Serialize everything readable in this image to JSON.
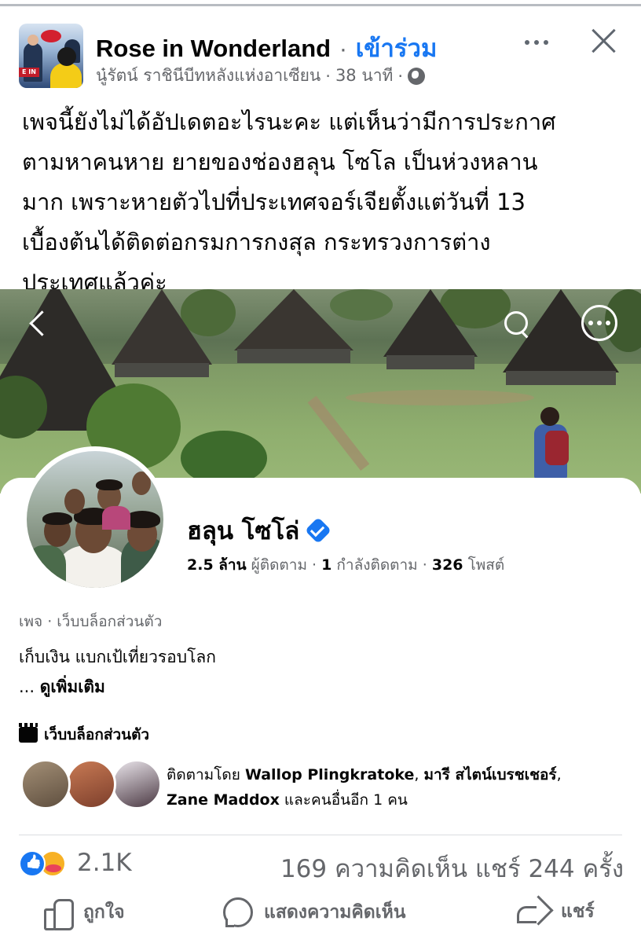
{
  "post": {
    "page_name": "Rose in Wonderland",
    "separator": "·",
    "join_label": "เข้าร่วม",
    "author": "นู๋รัตน์ ราชินีบีทหลังแห่งอาเซียน",
    "time": "38 นาที",
    "text_lines": [
      "เพจนี้ยังไม่ได้อัปเดตอะไรนะคะ แต่เห็นว่ามีการประกาศ",
      "ตามหาคนหาย ยายของช่องฮลุน โซโล เป็นห่วงหลาน",
      "มาก เพราะหายตัวไปที่ประเทศจอร์เจียตั้งแต่วันที่ 13",
      "เบื้องต้นได้ติดต่อกรมการกงสุล กระทรวงการต่าง",
      "ประเทศแล้วค่ะ"
    ]
  },
  "profile": {
    "name": "ฮลุน โซโล่",
    "followers_value": "2.5 ล้าน",
    "followers_label": "ผู้ติดตาม",
    "following_value": "1",
    "following_label": "กำลังติดตาม",
    "posts_value": "326",
    "posts_label": "โพสต์",
    "category": "เพจ · เว็บบล็อกส่วนตัว",
    "bio": "เก็บเงิน แบกเป้เที่ยวรอบโลก",
    "see_more_prefix": "...",
    "see_more": "ดูเพิ่มเติม",
    "blog_label": "เว็บบล็อกส่วนตัว",
    "followed_by_prefix": "ติดตามโดย",
    "followed_by_name1": "Wallop Plingkratoke",
    "followed_by_name2": "มารี สไตน์เบรชเชอร์",
    "followed_by_name3": "Zane Maddox",
    "followed_by_suffix": "และคนอื่นอีก 1 คน"
  },
  "reactions": {
    "count": "2.1K",
    "comments": "169 ความคิดเห็น",
    "shares": "แชร์ 244 ครั้ง"
  },
  "actions": {
    "like": "ถูกใจ",
    "comment": "แสดงความคิดเห็น",
    "share": "แชร์"
  },
  "colors": {
    "accent": "#1877f2",
    "muted": "#65676b",
    "text": "#050505"
  }
}
